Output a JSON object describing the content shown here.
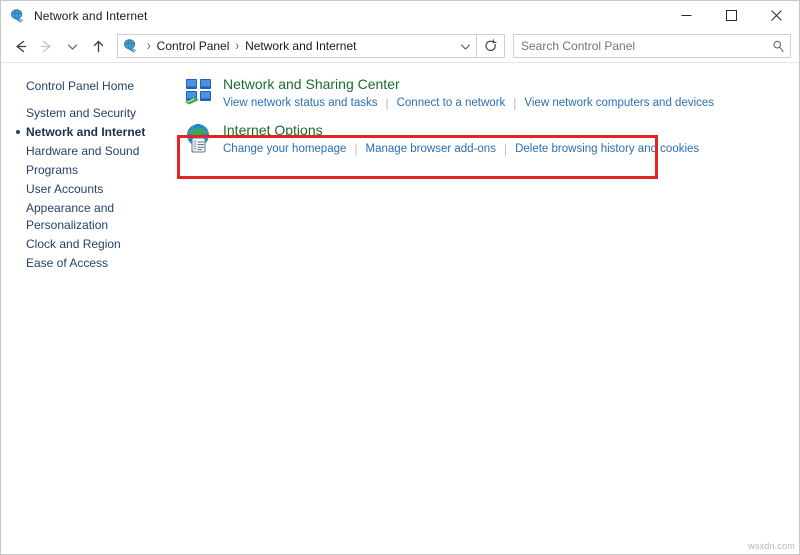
{
  "window": {
    "title": "Network and Internet",
    "title_icon": "network-globe-icon",
    "controls": {
      "minimize": "minimize-button",
      "maximize": "maximize-button",
      "close": "close-button"
    }
  },
  "nav": {
    "back": "back-arrow-icon",
    "forward": "forward-arrow-icon",
    "recent": "chevron-down-icon",
    "up": "up-arrow-icon",
    "address_icon": "network-globe-icon",
    "breadcrumbs": [
      "Control Panel",
      "Network and Internet"
    ],
    "separator": "›",
    "dropdown": "chevron-down-icon",
    "refresh": "refresh-icon"
  },
  "search": {
    "placeholder": "Search Control Panel",
    "value": "",
    "icon": "search-icon"
  },
  "sidebar": {
    "items": [
      {
        "label": "Control Panel Home",
        "current": false,
        "spaced": false
      },
      {
        "label": "System and Security",
        "current": false,
        "spaced": true
      },
      {
        "label": "Network and Internet",
        "current": true,
        "spaced": false
      },
      {
        "label": "Hardware and Sound",
        "current": false,
        "spaced": false
      },
      {
        "label": "Programs",
        "current": false,
        "spaced": false
      },
      {
        "label": "User Accounts",
        "current": false,
        "spaced": false
      },
      {
        "label": "Appearance and Personalization",
        "current": false,
        "spaced": false
      },
      {
        "label": "Clock and Region",
        "current": false,
        "spaced": false
      },
      {
        "label": "Ease of Access",
        "current": false,
        "spaced": false
      }
    ]
  },
  "content": {
    "categories": [
      {
        "title": "Network and Sharing Center",
        "icon": "network-sharing-center-icon",
        "links": [
          "View network status and tasks",
          "Connect to a network",
          "View network computers and devices"
        ]
      },
      {
        "title": "Internet Options",
        "icon": "internet-options-globe-icon",
        "links": [
          "Change your homepage",
          "Manage browser add-ons",
          "Delete browsing history and cookies"
        ]
      }
    ]
  },
  "annotation": {
    "highlight_color": "#e32424",
    "target": "Network and Sharing Center"
  },
  "watermark": {
    "text": "wsxdn.com"
  },
  "colors": {
    "category_title": "#1b6c2e",
    "link": "#2a6fb5",
    "sidebar_text": "#27416b",
    "sidebar_current": "#1b2f52",
    "window_bg": "#ffffff"
  }
}
